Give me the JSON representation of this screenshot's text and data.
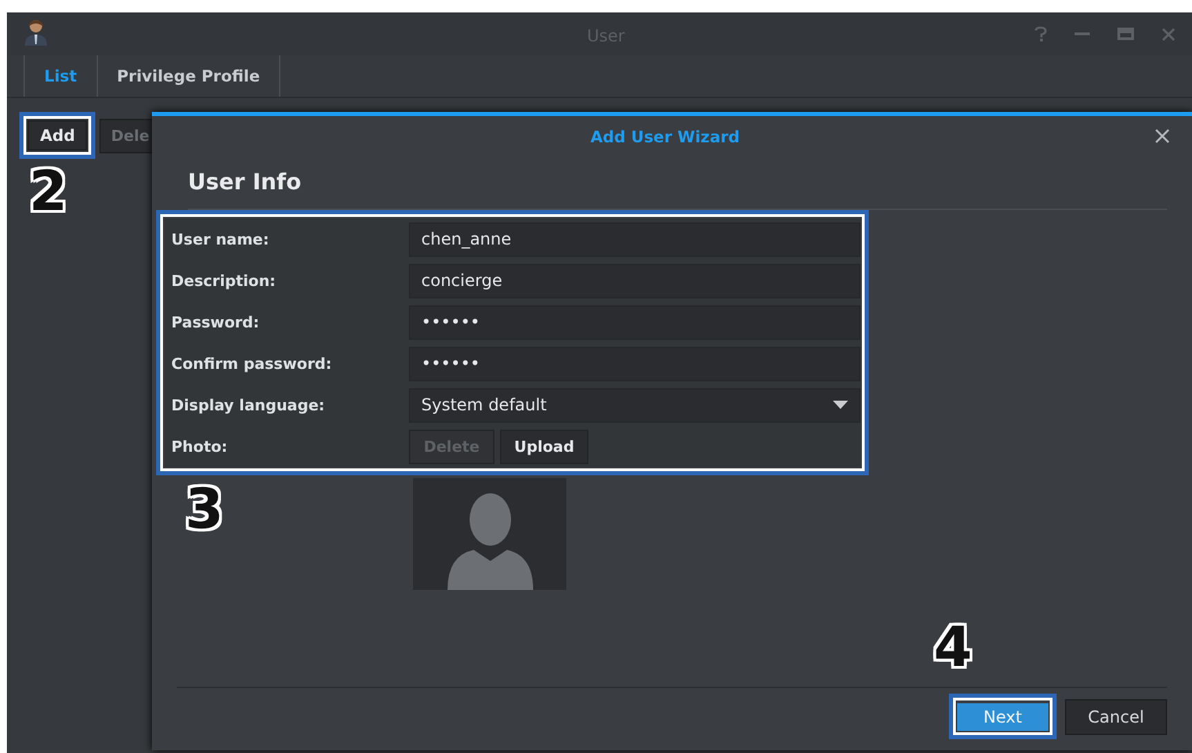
{
  "window": {
    "title": "User"
  },
  "tabs": [
    {
      "label": "List",
      "selected": true
    },
    {
      "label": "Privilege Profile",
      "selected": false
    }
  ],
  "toolbar": [
    {
      "label": "Add",
      "disabled": false
    },
    {
      "label": "Dele",
      "disabled": true
    }
  ],
  "dialog": {
    "title": "Add User Wizard",
    "heading": "User Info",
    "fields": [
      {
        "kind": "text",
        "label": "User name:",
        "value": "chen_anne"
      },
      {
        "kind": "text",
        "label": "Description:",
        "value": "concierge"
      },
      {
        "kind": "text",
        "label": "Password:",
        "value": "••••••"
      },
      {
        "kind": "text",
        "label": "Confirm password:",
        "value": "••••••"
      },
      {
        "kind": "select",
        "label": "Display language:",
        "value": "System default"
      },
      {
        "kind": "buttons",
        "label": "Photo:",
        "buttons": [
          {
            "label": "Delete",
            "disabled": true
          },
          {
            "label": "Upload",
            "disabled": false
          }
        ]
      }
    ],
    "buttons": [
      {
        "label": "Next",
        "primary": true
      },
      {
        "label": "Cancel",
        "primary": false
      }
    ]
  },
  "steps": [
    "2",
    "3",
    "4"
  ]
}
